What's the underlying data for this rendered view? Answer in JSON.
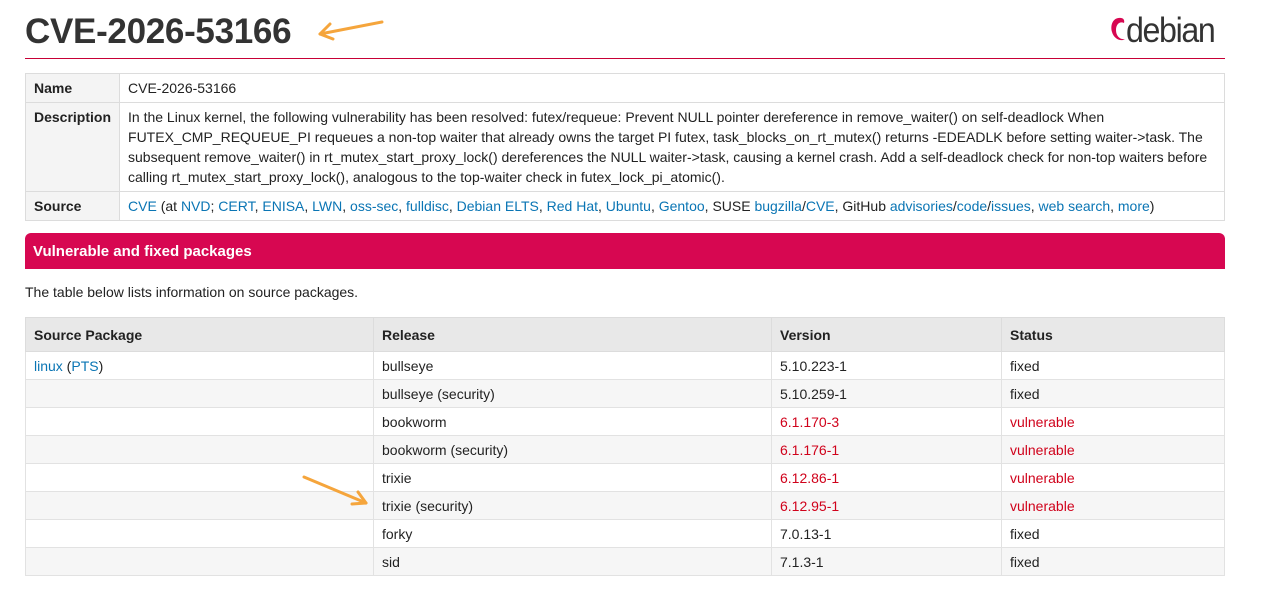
{
  "title": "CVE-2026-53166",
  "logo": {
    "text": "debian",
    "accent": "#d70751"
  },
  "info": {
    "name_label": "Name",
    "name_value": "CVE-2026-53166",
    "desc_label": "Description",
    "desc_value": "In the Linux kernel, the following vulnerability has been resolved: futex/requeue: Prevent NULL pointer dereference in remove_waiter() on self-deadlock When FUTEX_CMP_REQUEUE_PI requeues a non-top waiter that already owns the target PI futex, task_blocks_on_rt_mutex() returns -EDEADLK before setting waiter->task. The subsequent remove_waiter() in rt_mutex_start_proxy_lock() dereferences the NULL waiter->task, causing a kernel crash. Add a self-deadlock check for non-top waiters before calling rt_mutex_start_proxy_lock(), analogous to the top-waiter check in futex_lock_pi_atomic().",
    "source_label": "Source",
    "source": {
      "cve": "CVE",
      "at": " (at ",
      "nvd": "NVD",
      "cert": "CERT",
      "enisa": "ENISA",
      "lwn": "LWN",
      "oss_sec": "oss-sec",
      "fulldisc": "fulldisc",
      "debian_elts": "Debian ELTS",
      "red_hat": "Red Hat",
      "ubuntu": "Ubuntu",
      "gentoo": "Gentoo",
      "suse": "SUSE ",
      "bugzilla": "bugzilla",
      "suse_cve": "CVE",
      "github": "GitHub ",
      "advisories": "advisories",
      "code": "code",
      "issues": "issues",
      "web_search": "web search",
      "more": "more",
      "close": ")"
    }
  },
  "section_title": "Vulnerable and fixed packages",
  "intro": "The table below lists information on source packages.",
  "packages": {
    "headers": [
      "Source Package",
      "Release",
      "Version",
      "Status"
    ],
    "source_name": "linux",
    "pts": "PTS",
    "rows": [
      {
        "release": "bullseye",
        "version": "5.10.223-1",
        "status": "fixed"
      },
      {
        "release": "bullseye (security)",
        "version": "5.10.259-1",
        "status": "fixed"
      },
      {
        "release": "bookworm",
        "version": "6.1.170-3",
        "status": "vulnerable"
      },
      {
        "release": "bookworm (security)",
        "version": "6.1.176-1",
        "status": "vulnerable"
      },
      {
        "release": "trixie",
        "version": "6.12.86-1",
        "status": "vulnerable"
      },
      {
        "release": "trixie (security)",
        "version": "6.12.95-1",
        "status": "vulnerable"
      },
      {
        "release": "forky",
        "version": "7.0.13-1",
        "status": "fixed"
      },
      {
        "release": "sid",
        "version": "7.1.3-1",
        "status": "fixed"
      }
    ]
  },
  "colors": {
    "vulnerable": "#d0021b",
    "link": "#0a75b4",
    "banner": "#d70751",
    "annotation_arrow": "#f5a53c"
  }
}
